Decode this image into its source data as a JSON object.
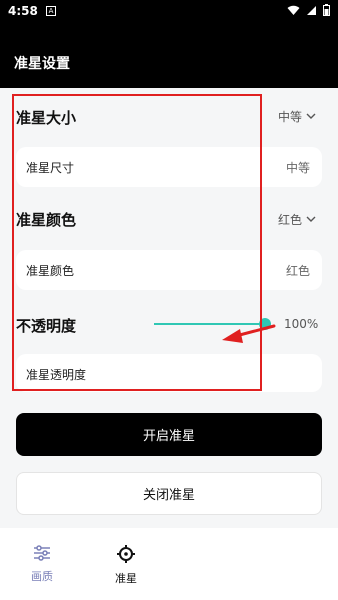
{
  "status_bar": {
    "time": "4:58",
    "notification_badge": "A",
    "icons": [
      "wifi-icon",
      "signal-icon",
      "battery-icon"
    ]
  },
  "header": {
    "title": "准星设置"
  },
  "sections": {
    "size": {
      "label": "准星大小",
      "dropdown_value": "中等",
      "card_label": "准星尺寸",
      "card_value": "中等"
    },
    "color": {
      "label": "准星颜色",
      "dropdown_value": "红色",
      "card_label": "准星颜色",
      "card_value": "红色"
    },
    "opacity": {
      "label": "不透明度",
      "value_text": "100%",
      "value": 1.0,
      "card_label": "准星透明度"
    }
  },
  "buttons": {
    "enable": "开启准星",
    "disable": "关闭准星"
  },
  "bottom_nav": {
    "items": [
      {
        "label": "画质",
        "icon": "sliders-icon",
        "active": false
      },
      {
        "label": "准星",
        "icon": "crosshair-icon",
        "active": true
      }
    ]
  },
  "colors": {
    "accent": "#2fc7b4",
    "annotation": "#e02020",
    "primary_button": "#000000"
  }
}
